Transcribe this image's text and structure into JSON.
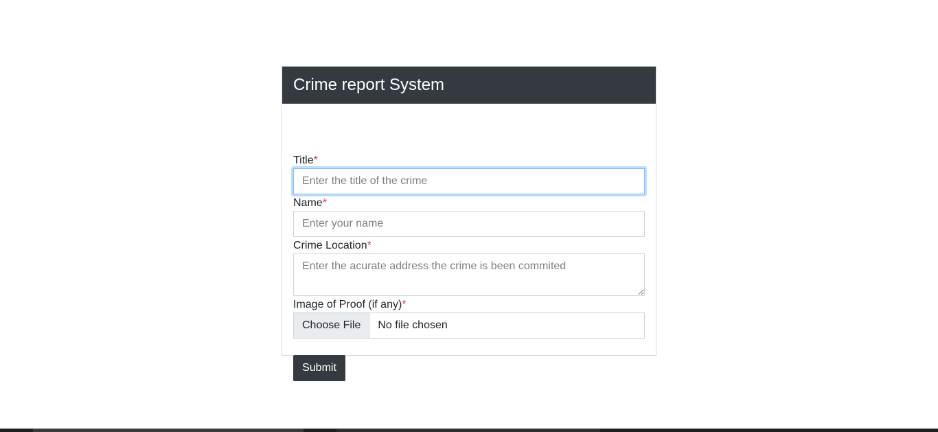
{
  "card": {
    "title": "Crime report System"
  },
  "form": {
    "title_field": {
      "label": "Title",
      "required_mark": "*",
      "placeholder": "Enter the title of the crime",
      "value": ""
    },
    "name_field": {
      "label": "Name",
      "required_mark": "*",
      "placeholder": "Enter your name",
      "value": ""
    },
    "location_field": {
      "label": "Crime Location",
      "required_mark": "*",
      "placeholder": "Enter the acurate address the crime is been commited",
      "value": ""
    },
    "image_field": {
      "label": "Image of Proof (if any)",
      "required_mark": "*",
      "button_label": "Choose File",
      "status": "No file chosen"
    },
    "submit_label": "Submit"
  },
  "colors": {
    "header_bg": "#343a40",
    "required": "#dc3545",
    "focus_border": "#80bdff"
  }
}
